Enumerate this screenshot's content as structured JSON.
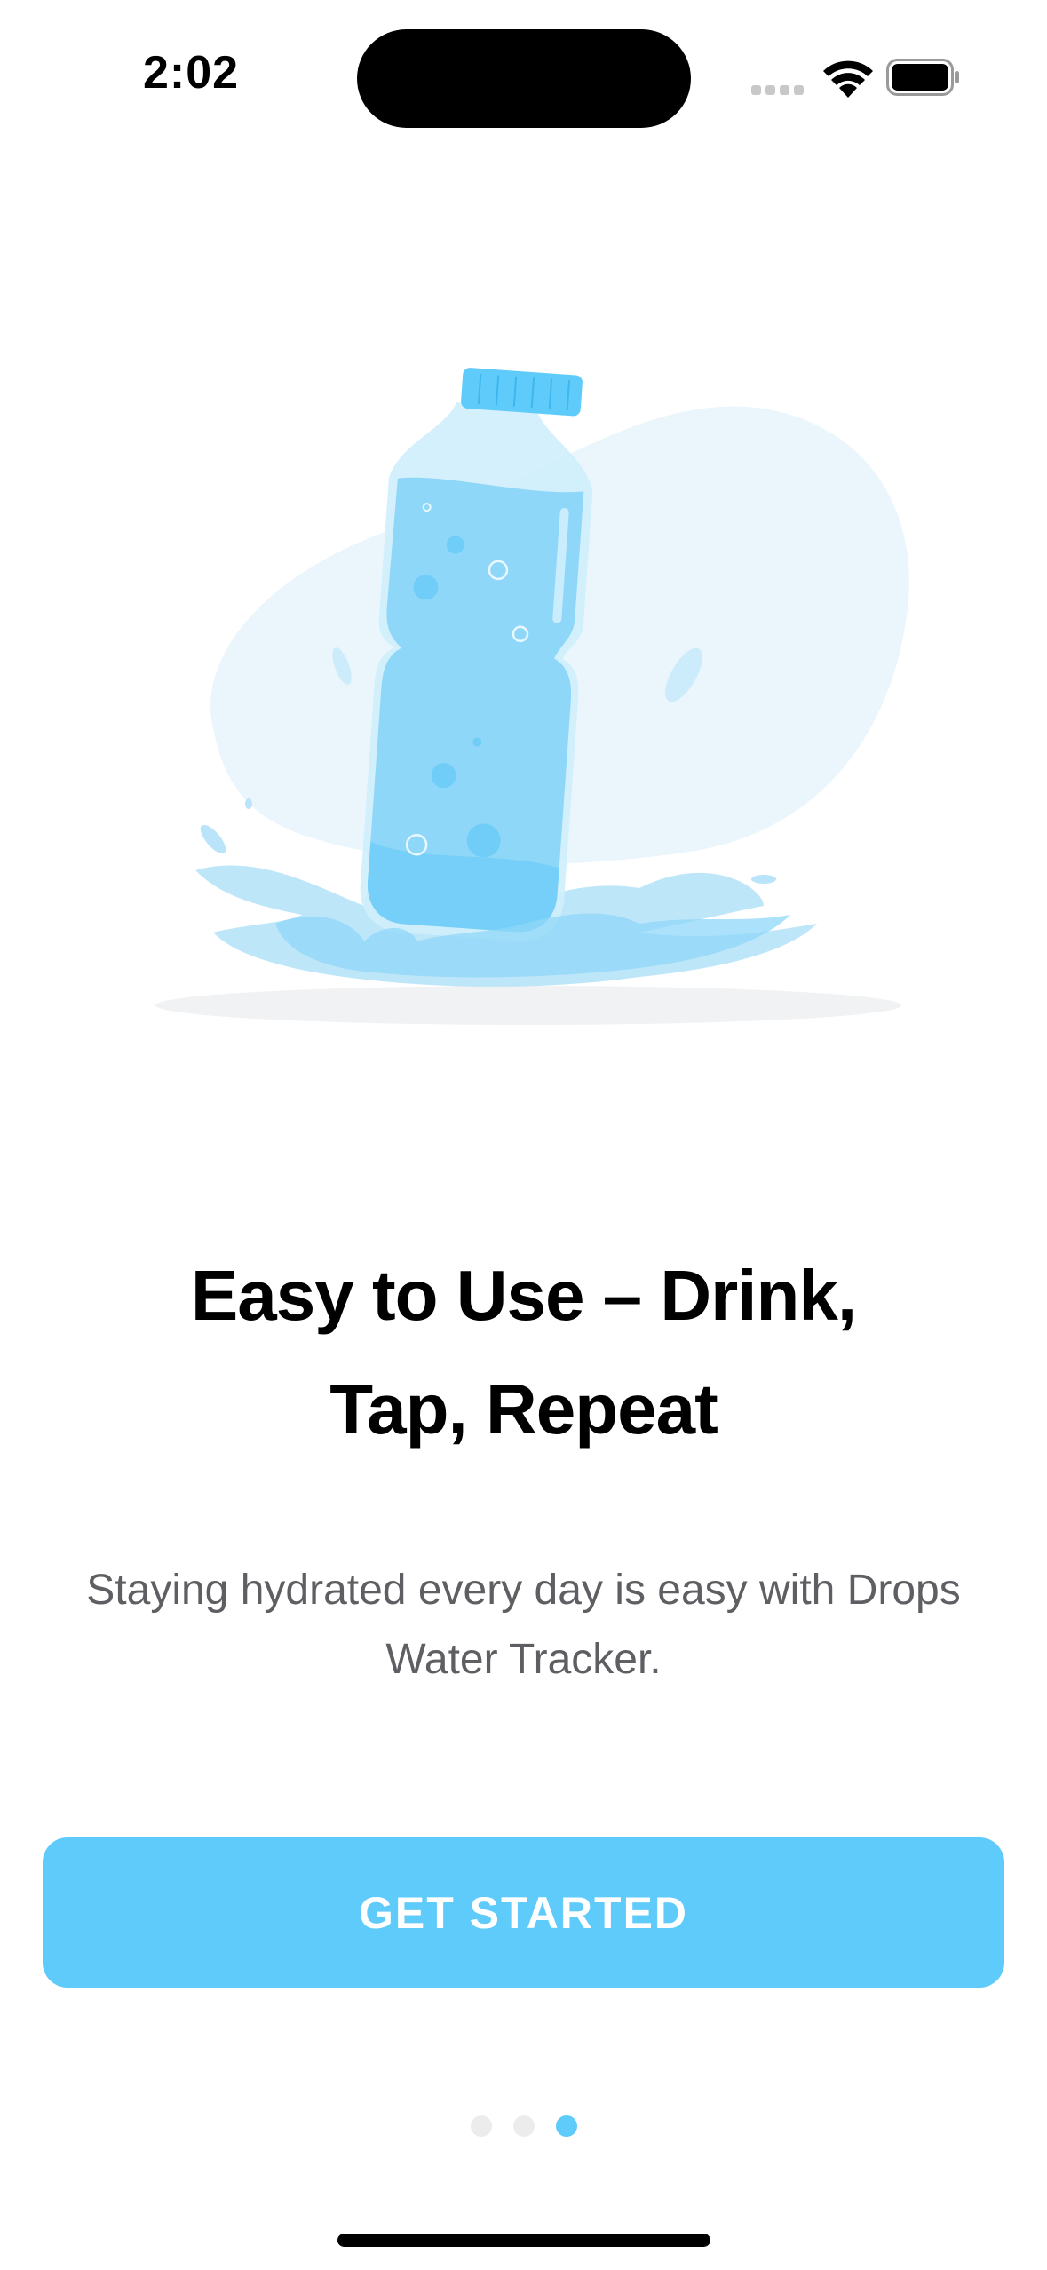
{
  "status_bar": {
    "time": "2:02",
    "signal_icon": "cellular-signal-icon",
    "wifi_icon": "wifi-icon",
    "battery_icon": "battery-icon"
  },
  "illustration": {
    "icon": "water-bottle-splash-illustration",
    "accent_color": "#5ecbfa"
  },
  "onboarding": {
    "title_line1": "Easy to Use – Drink,",
    "title_line2": "Tap, Repeat",
    "subtitle_line1": "Staying hydrated every day is easy with Drops",
    "subtitle_line2": "Water Tracker.",
    "cta_label": "GET STARTED"
  },
  "pagination": {
    "total_pages": 3,
    "current_page": 3
  },
  "colors": {
    "accent": "#5ecbfa",
    "subtitle_text": "#5e5e63",
    "inactive_dot": "#ececec"
  }
}
